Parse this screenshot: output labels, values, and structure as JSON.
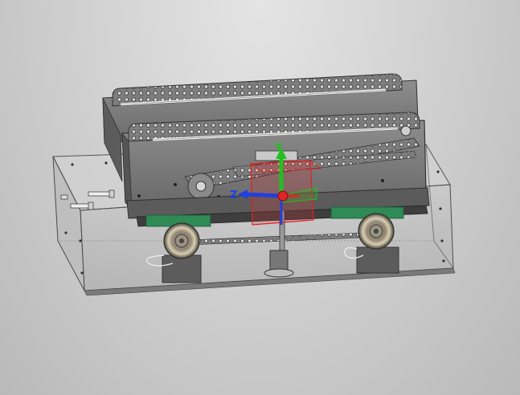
{
  "viewport": {
    "background_top": "#e4e4e4",
    "background_bottom": "#b9b9b9"
  },
  "triad": {
    "x_label": "",
    "y_label": "Y",
    "z_label": "Z",
    "x_color": "#e0242a",
    "y_color": "#20c020",
    "z_color": "#2040e0"
  },
  "model": {
    "frame_color": "#4a4a4a",
    "chain_color": "#6a6a6a",
    "pad_color": "#2f8a55"
  }
}
